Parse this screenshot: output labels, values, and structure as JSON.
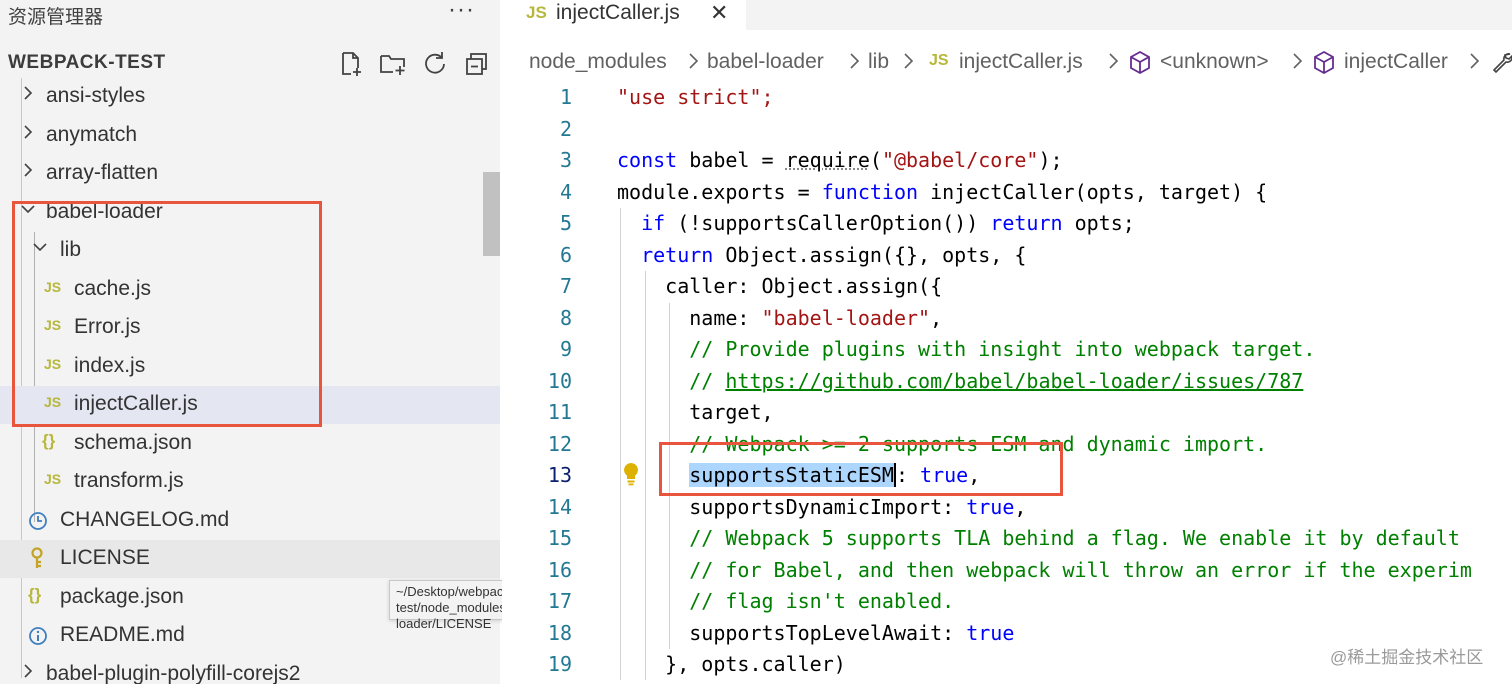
{
  "sidebar": {
    "title": "资源管理器",
    "more": "···",
    "section_title": "WEBPACK-TEST",
    "actions": [
      "new-file-icon",
      "new-folder-icon",
      "refresh-icon",
      "collapse-all-icon"
    ],
    "items": [
      {
        "label": "ansi-styles",
        "type": "folder",
        "expanded": false
      },
      {
        "label": "anymatch",
        "type": "folder",
        "expanded": false
      },
      {
        "label": "array-flatten",
        "type": "folder",
        "expanded": false
      },
      {
        "label": "babel-loader",
        "type": "folder",
        "expanded": true
      },
      {
        "label": "lib",
        "type": "folder",
        "expanded": true
      },
      {
        "label": "cache.js",
        "type": "js",
        "icon": "JS"
      },
      {
        "label": "Error.js",
        "type": "js",
        "icon": "JS"
      },
      {
        "label": "index.js",
        "type": "js",
        "icon": "JS"
      },
      {
        "label": "injectCaller.js",
        "type": "js",
        "icon": "JS"
      },
      {
        "label": "schema.json",
        "type": "json",
        "icon": "{}"
      },
      {
        "label": "transform.js",
        "type": "js",
        "icon": "JS"
      },
      {
        "label": "CHANGELOG.md",
        "type": "clock"
      },
      {
        "label": "LICENSE",
        "type": "license"
      },
      {
        "label": "package.json",
        "type": "json",
        "icon": "{}"
      },
      {
        "label": "README.md",
        "type": "info"
      },
      {
        "label": "babel-plugin-polyfill-corejs2",
        "type": "folder",
        "expanded": false
      }
    ],
    "tooltip": "~/Desktop/webpack-test/node_modules/babel-loader/LICENSE"
  },
  "editor": {
    "tab": {
      "badge": "JS",
      "label": "injectCaller.js",
      "close": "✕"
    },
    "breadcrumb": {
      "parts": [
        "node_modules",
        "babel-loader",
        "lib",
        "injectCaller.js",
        "<unknown>",
        "injectCaller"
      ],
      "js_badge": "JS"
    },
    "line_numbers": [
      "1",
      "2",
      "3",
      "4",
      "5",
      "6",
      "7",
      "8",
      "9",
      "10",
      "11",
      "12",
      "13",
      "14",
      "15",
      "16",
      "17",
      "18",
      "19"
    ],
    "code": {
      "l1": "\"use strict\";",
      "l3a": "const",
      "l3b": " babel = ",
      "l3c": "require",
      "l3d": "(",
      "l3e": "\"@babel/core\"",
      "l3f": ");",
      "l4a": "module.exports = ",
      "l4b": "function",
      "l4c": " injectCaller(opts, target) {",
      "l5a": "  ",
      "l5b": "if",
      "l5c": " (!supportsCallerOption()) ",
      "l5d": "return",
      "l5e": " opts;",
      "l6a": "  ",
      "l6b": "return",
      "l6c": " Object.assign({}, opts, {",
      "l7": "    caller: Object.assign({",
      "l8a": "      name: ",
      "l8b": "\"babel-loader\"",
      "l8c": ",",
      "l9": "      // Provide plugins with insight into webpack target.",
      "l10a": "      // ",
      "l10b": "https://github.com/babel/babel-loader/issues/787",
      "l11": "      target,",
      "l12": "      // Webpack >= 2 supports ESM and dynamic import.",
      "l13a": "      ",
      "l13b": "supportsStaticESM",
      "l13c": ": ",
      "l13d": "true",
      "l13e": ",",
      "l14a": "      supportsDynamicImport: ",
      "l14b": "true",
      "l14c": ",",
      "l15": "      // Webpack 5 supports TLA behind a flag. We enable it by default",
      "l16": "      // for Babel, and then webpack will throw an error if the experim",
      "l17": "      // flag isn't enabled.",
      "l18a": "      supportsTopLevelAwait: ",
      "l18b": "true",
      "l19": "    }, opts.caller)"
    }
  },
  "watermark": "@稀土掘金技术社区",
  "colors": {
    "highlight_box": "#e8543c",
    "keyword": "#0000ff",
    "string": "#a31515",
    "comment": "#008000"
  }
}
